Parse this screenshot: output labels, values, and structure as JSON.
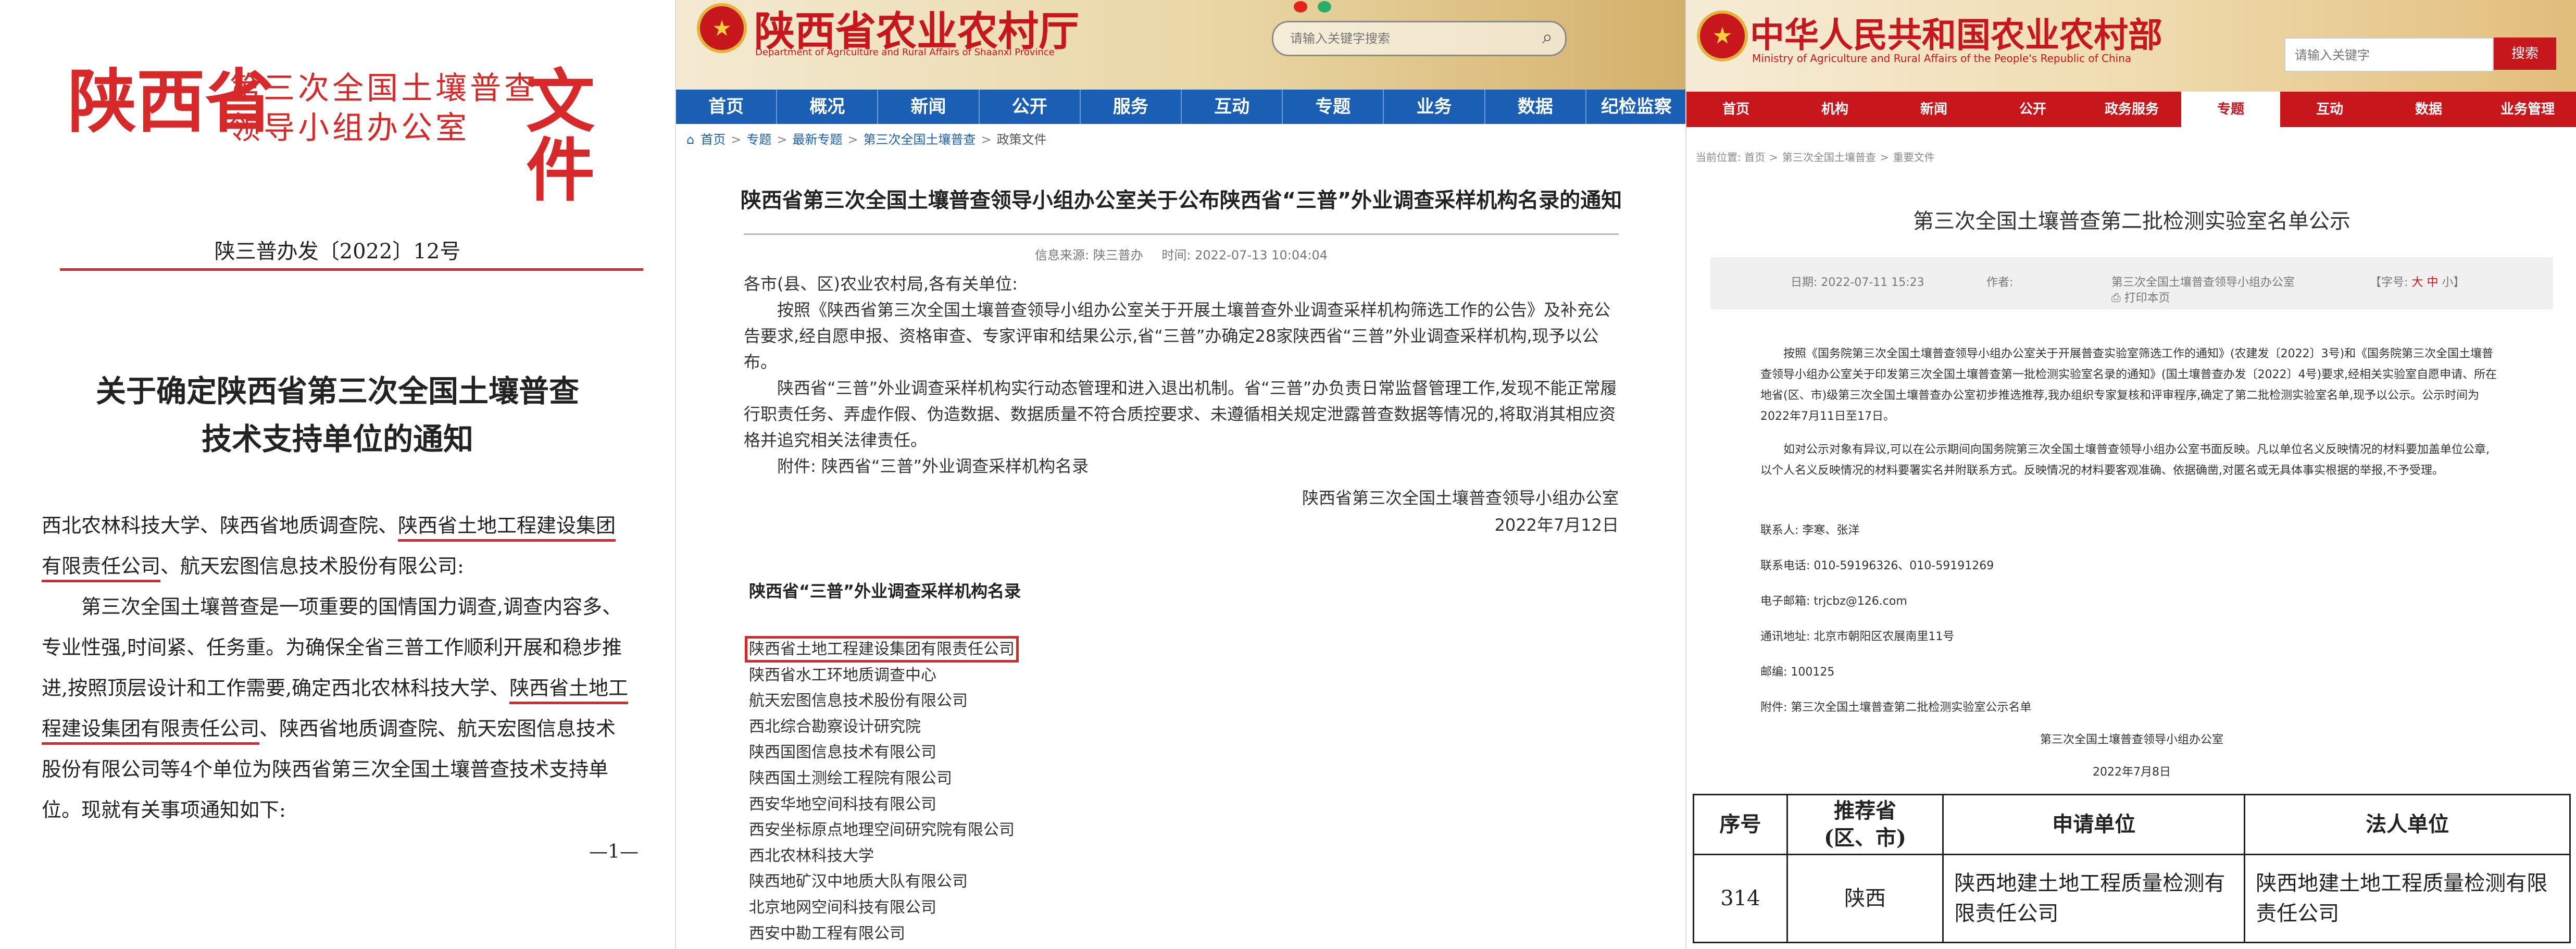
{
  "doc": {
    "header_big1": "陕西省",
    "header_mid1": "第三次全国土壤普查",
    "header_mid2": "领导小组办公室",
    "header_big2": "文件",
    "doc_no": "陕三普办发〔2022〕12号",
    "title_line1": "关于确定陕西省第三次全国土壤普查",
    "title_line2": "技术支持单位的通知",
    "salutation_a": "西北农林科技大学、陕西省地质调查院、",
    "salutation_b": "陕西省土地工程建设集团有限责任公司",
    "salutation_c": "、航天宏图信息技术股份有限公司:",
    "para_a": "第三次全国土壤普查是一项重要的国情国力调查,调查内容多、专业性强,时间紧、任务重。为确保全省三普工作顺利开展和稳步推进,按照顶层设计和工作需要,确定西北农林科技大学、",
    "para_b": "陕西省土地工程建设集团有限责任公司",
    "para_c": "、陕西省地质调查院、航天宏图信息技术股份有限公司等4个单位为陕西省第三次全国土壤普查技术支持单位。现就有关事项通知如下:",
    "page_no": "—1—"
  },
  "provincial": {
    "site_name": "陕西省农业农村厅",
    "site_name_en": "Department of Agriculture and Rural Affairs of Shaanxi Province",
    "search_placeholder": "请输入关键字搜索",
    "nav": [
      "首页",
      "概况",
      "新闻",
      "公开",
      "服务",
      "互动",
      "专题",
      "业务",
      "数据",
      "纪检监察"
    ],
    "breadcrumb": [
      "首页",
      "专题",
      "最新专题",
      "第三次全国土壤普查",
      "政策文件"
    ],
    "title": "陕西省第三次全国土壤普查领导小组办公室关于公布陕西省“三普”外业调查采样机构名录的通知",
    "source": "信息来源: 陕三普办",
    "time": "时间: 2022-07-13 10:04:04",
    "salutation": "各市(县、区)农业农村局,各有关单位:",
    "para1": "按照《陕西省第三次全国土壤普查领导小组办公室关于开展土壤普查外业调查采样机构筛选工作的公告》及补充公告要求,经自愿申报、资格审查、专家评审和结果公示,省“三普”办确定28家陕西省“三普”外业调查采样机构,现予以公布。",
    "para2": "陕西省“三普”外业调查采样机构实行动态管理和进入退出机制。省“三普”办负责日常监督管理工作,发现不能正常履行职责任务、弄虚作假、伪造数据、数据质量不符合质控要求、未遵循相关规定泄露普查数据等情况的,将取消其相应资格并追究相关法律责任。",
    "attachment": "附件: 陕西省“三普”外业调查采样机构名录",
    "signer": "陕西省第三次全国土壤普查领导小组办公室",
    "sign_date": "2022年7月12日",
    "list_title": "陕西省“三普”外业调查采样机构名录",
    "institutions": [
      "陕西省土地工程建设集团有限责任公司",
      "陕西省水工环地质调查中心",
      "航天宏图信息技术股份有限公司",
      "西北综合勘察设计研究院",
      "陕西国图信息技术有限公司",
      "陕西国土测绘工程院有限公司",
      "西安华地空间科技有限公司",
      "西安坐标原点地理空间研究院有限公司",
      "西北农林科技大学",
      "陕西地矿汉中地质大队有限公司",
      "北京地网空间科技有限公司",
      "西安中勘工程有限公司"
    ]
  },
  "national": {
    "site_name": "中华人民共和国农业农村部",
    "site_name_en": "Ministry of Agriculture and Rural Affairs of the People's Republic of China",
    "search_placeholder": "请输入关键字",
    "search_button": "搜索",
    "nav": [
      "首页",
      "机构",
      "新闻",
      "公开",
      "政务服务",
      "专题",
      "互动",
      "数据",
      "业务管理"
    ],
    "active_nav": "专题",
    "breadcrumb": [
      "当前位置: 首页",
      "第三次全国土壤普查",
      "重要文件"
    ],
    "title": "第三次全国土壤普查第二批检测实验室名单公示",
    "date": "日期: 2022-07-11 15:23",
    "author_label": "作者:",
    "author": "第三次全国土壤普查领导小组办公室",
    "print": "打印本页",
    "font_size_label": "【字号:",
    "font_large": "大",
    "font_mid": "中",
    "font_small": "小】",
    "para1": "按照《国务院第三次全国土壤普查领导小组办公室关于开展普查实验室筛选工作的通知》(农建发〔2022〕3号)和《国务院第三次全国土壤普查领导小组办公室关于印发第三次全国土壤普查第一批检测实验室名录的通知》(国土壤普查办发〔2022〕4号)要求,经相关实验室自愿申请、所在地省(区、市)级第三次全国土壤普查办公室初步推选推荐,我办组织专家复核和评审程序,确定了第二批检测实验室名单,现予以公示。公示时间为2022年7月11日至17日。",
    "para2": "如对公示对象有异议,可以在公示期间向国务院第三次全国土壤普查领导小组办公室书面反映。凡以单位名义反映情况的材料要加盖单位公章,以个人名义反映情况的材料要署实名并附联系方式。反映情况的材料要客观准确、依据确凿,对匿名或无具体事实根据的举报,不予受理。",
    "contact_person": "联系人: 李寒、张洋",
    "phone": "联系电话: 010-59196326、010-59191269",
    "email": "电子邮箱: trjcbz@126.com",
    "address": "通讯地址: 北京市朝阳区农展南里11号",
    "postcode": "邮编: 100125",
    "attachment": "附件: 第三次全国土壤普查第二批检测实验室公示名单",
    "signer": "第三次全国土壤普查领导小组办公室",
    "sign_date": "2022年7月8日",
    "table": {
      "headers": [
        "序号",
        "推荐省",
        "(区、市)",
        "申请单位",
        "法人单位"
      ],
      "row": [
        "314",
        "陕西",
        "陕西地建土地工程质量检测有限责任公司",
        "陕西地建土地工程质量检测有限责任公司"
      ]
    }
  },
  "colors": {
    "doc_red": "#d7282a",
    "provincial_nav": "#1a5fb4",
    "national_red": "#c8161d"
  }
}
